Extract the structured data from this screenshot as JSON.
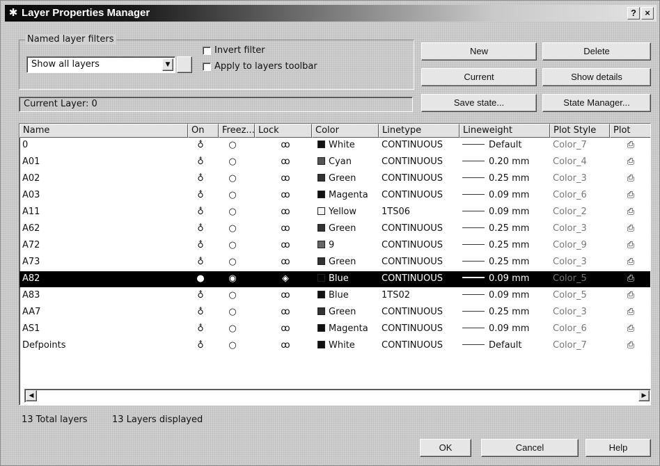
{
  "window": {
    "title": "Layer Properties Manager",
    "help_label": "?",
    "close_label": "×",
    "icon": "layers-app-icon"
  },
  "filters": {
    "legend": "Named layer filters",
    "selected": "Show all layers",
    "invert_filter_label": "Invert filter",
    "invert_filter_checked": false,
    "apply_toolbar_label": "Apply to layers toolbar",
    "apply_toolbar_checked": false
  },
  "buttons": {
    "new": "New",
    "delete": "Delete",
    "current": "Current",
    "show_details": "Show details",
    "save_state": "Save state...",
    "state_manager": "State Manager...",
    "ok": "OK",
    "cancel": "Cancel",
    "help": "Help"
  },
  "current_layer": "Current Layer: 0",
  "table": {
    "columns": [
      "Name",
      "On",
      "Freez...",
      "Lock",
      "Color",
      "Linetype",
      "Lineweight",
      "Plot Style",
      "Plot"
    ],
    "rows": [
      {
        "name": "0",
        "color": "White",
        "swatch": "#111111",
        "linetype": "CONTINUOUS",
        "lineweight": "Default",
        "plot_style": "Color_7"
      },
      {
        "name": "A01",
        "color": "Cyan",
        "swatch": "#555555",
        "linetype": "CONTINUOUS",
        "lineweight": "0.20 mm",
        "plot_style": "Color_4"
      },
      {
        "name": "A02",
        "color": "Green",
        "swatch": "#333333",
        "linetype": "CONTINUOUS",
        "lineweight": "0.25 mm",
        "plot_style": "Color_3"
      },
      {
        "name": "A03",
        "color": "Magenta",
        "swatch": "#111111",
        "linetype": "CONTINUOUS",
        "lineweight": "0.09 mm",
        "plot_style": "Color_6"
      },
      {
        "name": "A11",
        "color": "Yellow",
        "swatch": "#f4f4f4",
        "linetype": "1TS06",
        "lineweight": "0.09 mm",
        "plot_style": "Color_2"
      },
      {
        "name": "A62",
        "color": "Green",
        "swatch": "#333333",
        "linetype": "CONTINUOUS",
        "lineweight": "0.25 mm",
        "plot_style": "Color_3"
      },
      {
        "name": "A72",
        "color": "9",
        "swatch": "#666666",
        "linetype": "CONTINUOUS",
        "lineweight": "0.25 mm",
        "plot_style": "Color_9"
      },
      {
        "name": "A73",
        "color": "Green",
        "swatch": "#333333",
        "linetype": "CONTINUOUS",
        "lineweight": "0.25 mm",
        "plot_style": "Color_3"
      },
      {
        "name": "A82",
        "color": "Blue",
        "swatch": "#000000",
        "linetype": "CONTINUOUS",
        "lineweight": "0.09 mm",
        "plot_style": "Color_5",
        "selected": true
      },
      {
        "name": "A83",
        "color": "Blue",
        "swatch": "#111111",
        "linetype": "1TS02",
        "lineweight": "0.09 mm",
        "plot_style": "Color_5"
      },
      {
        "name": "AA7",
        "color": "Green",
        "swatch": "#333333",
        "linetype": "CONTINUOUS",
        "lineweight": "0.25 mm",
        "plot_style": "Color_3"
      },
      {
        "name": "AS1",
        "color": "Magenta",
        "swatch": "#111111",
        "linetype": "CONTINUOUS",
        "lineweight": "0.09 mm",
        "plot_style": "Color_6"
      },
      {
        "name": "Defpoints",
        "color": "White",
        "swatch": "#111111",
        "linetype": "CONTINUOUS",
        "lineweight": "Default",
        "plot_style": "Color_7"
      }
    ]
  },
  "status": {
    "total": "13 Total layers",
    "displayed": "13 Layers displayed"
  }
}
